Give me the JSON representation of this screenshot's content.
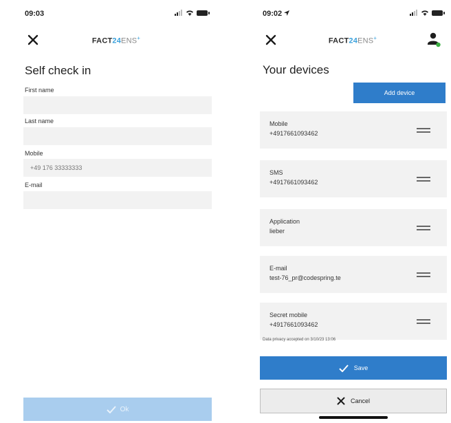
{
  "left_screen": {
    "status_time": "09:03",
    "logo": {
      "part1": "FACT",
      "part2": "24",
      "part3": "ENS",
      "part4": "+"
    },
    "title": "Self check in",
    "fields": [
      {
        "label": "First name",
        "value": "",
        "placeholder": ""
      },
      {
        "label": "Last name",
        "value": "",
        "placeholder": ""
      },
      {
        "label": "Mobile",
        "value": "",
        "placeholder": "+49 176 33333333"
      },
      {
        "label": "E-mail",
        "value": "",
        "placeholder": ""
      }
    ],
    "ok_label": "Ok"
  },
  "right_screen": {
    "status_time": "09:02",
    "logo": {
      "part1": "FACT",
      "part2": "24",
      "part3": "ENS",
      "part4": "+"
    },
    "title": "Your devices",
    "add_device_label": "Add device",
    "devices": [
      {
        "type": "Mobile",
        "value": "+4917661093462"
      },
      {
        "type": "SMS",
        "value": "+4917661093462"
      },
      {
        "type": "Application",
        "value": "lieber"
      },
      {
        "type": "E-mail",
        "value": "test-76_pr@codespring.te"
      },
      {
        "type": "Secret mobile",
        "value": "+4917661093462"
      }
    ],
    "privacy_note": "Data privacy accepted on 3/10/23 13:06",
    "save_label": "Save",
    "cancel_label": "Cancel"
  },
  "colors": {
    "primary": "#2f7dca",
    "primary_disabled": "#a9cdee",
    "logo_accent": "#3aa1dc",
    "field_bg": "#f2f2f2",
    "status_online": "#3cb043"
  },
  "icons": [
    "close-icon",
    "user-icon",
    "checkmark-icon",
    "drag-handle-icon",
    "signal-icon",
    "wifi-icon",
    "battery-icon",
    "location-arrow-icon"
  ]
}
